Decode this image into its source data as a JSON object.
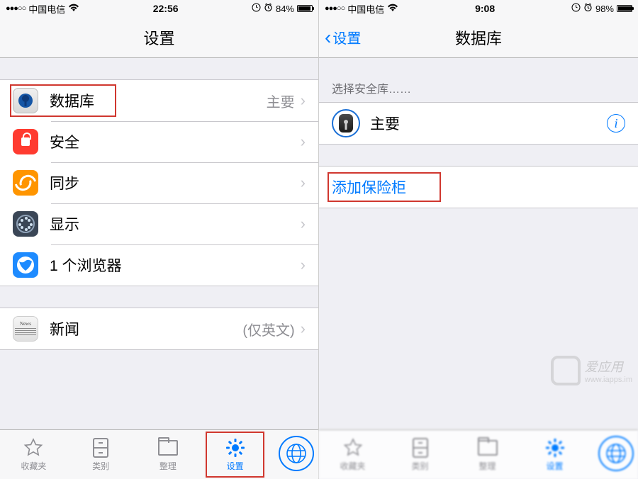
{
  "left": {
    "status": {
      "signal": "●●●○○",
      "carrier": "中国电信",
      "time": "22:56",
      "battery_pct": "84%",
      "battery_fill_pct": 84
    },
    "nav": {
      "title": "设置"
    },
    "rows": {
      "database": {
        "label": "数据库",
        "detail": "主要"
      },
      "security": {
        "label": "安全"
      },
      "sync": {
        "label": "同步"
      },
      "display": {
        "label": "显示"
      },
      "browser": {
        "label": "1 个浏览器"
      },
      "news": {
        "label": "新闻",
        "detail": "(仅英文)"
      }
    },
    "tabs": {
      "favorites": "收藏夹",
      "categories": "类别",
      "organize": "整理",
      "settings": "设置"
    }
  },
  "right": {
    "status": {
      "signal": "●●●○○",
      "carrier": "中国电信",
      "time": "9:08",
      "battery_pct": "98%",
      "battery_fill_pct": 98
    },
    "nav": {
      "back": "设置",
      "title": "数据库"
    },
    "section_header": "选择安全库……",
    "vault": {
      "label": "主要"
    },
    "add_vault": "添加保险柜",
    "tabs": {
      "favorites": "收藏夹",
      "categories": "类别",
      "organize": "整理",
      "settings": "设置"
    }
  },
  "watermark": {
    "brand": "爱应用",
    "url": "www.iapps.im"
  }
}
